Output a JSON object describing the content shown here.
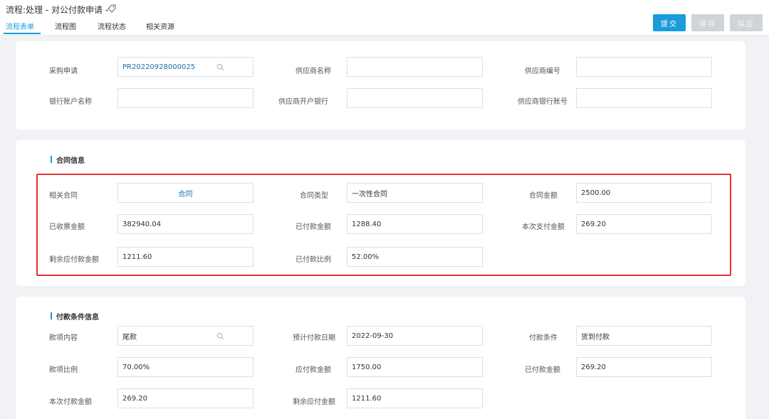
{
  "header": {
    "title": "流程:处理 - 对公付款申请 -",
    "tag_icon": "tag-icon",
    "tabs": [
      "流程表单",
      "流程图",
      "流程状态",
      "相关资源"
    ],
    "buttons": {
      "submit": "提交",
      "save": "保存",
      "draft": "拟定"
    },
    "colors": {
      "accent": "#1a9bdb",
      "highlight": "#e5322d"
    }
  },
  "purchase": {
    "purchase_request_label": "采购申请",
    "purchase_request_value": "PR20220928000025",
    "supplier_name_label": "供应商名称",
    "supplier_code_label": "供应商编号",
    "bank_account_name_label": "银行账户名称",
    "supplier_bank_label": "供应商开户银行",
    "supplier_bank_account_label": "供应商银行账号"
  },
  "contract": {
    "title": "合同信息",
    "related_contract_label": "相关合同",
    "related_contract_value": "合同",
    "contract_type_label": "合同类型",
    "contract_type_value": "一次性合同",
    "contract_amount_label": "合同金额",
    "contract_amount_value": "2500.00",
    "received_amount_label": "已收票金额",
    "received_amount_value": "382940.04",
    "paid_amount_label": "已付款金额",
    "paid_amount_value": "1288.40",
    "current_payment_label": "本次支付金额",
    "current_payment_value": "269.20",
    "remaining_label": "剩余应付款金额",
    "remaining_value": "1211.60",
    "paid_ratio_label": "已付款比例",
    "paid_ratio_value": "52.00%"
  },
  "payment_terms": {
    "title": "付款条件信息",
    "item_content_label": "款项内容",
    "item_content_value": "尾款",
    "expected_date_label": "预计付款日期",
    "expected_date_value": "2022-09-30",
    "payment_condition_label": "付款条件",
    "payment_condition_value": "货到付款",
    "item_ratio_label": "款项比例",
    "item_ratio_value": "70.00%",
    "payable_amount_label": "应付款金额",
    "payable_amount_value": "1750.00",
    "paid_amount_label": "已付款金额",
    "paid_amount_value": "269.20",
    "current_payment_label": "本次付款金额",
    "current_payment_value": "269.20",
    "remaining_label": "剩余应付金额",
    "remaining_value": "1211.60"
  }
}
